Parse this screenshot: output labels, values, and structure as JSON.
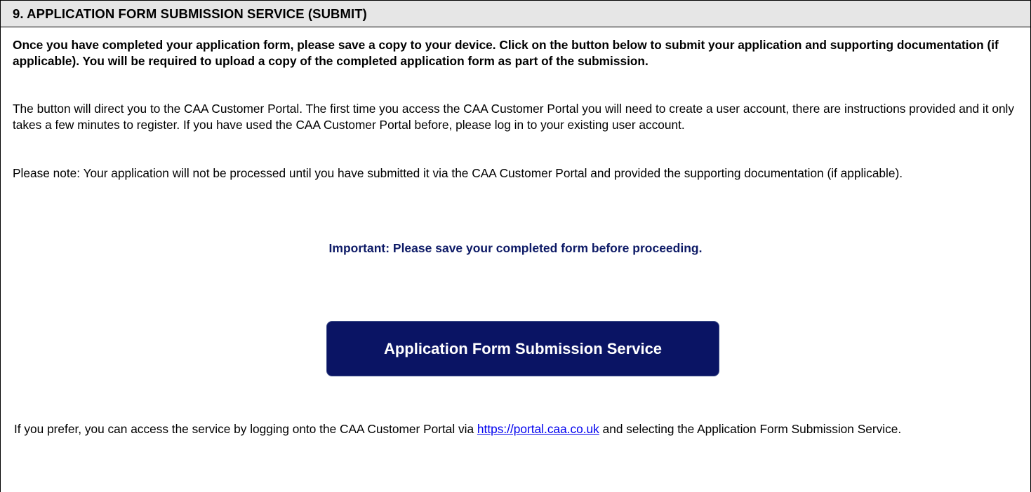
{
  "header": {
    "title": "9. APPLICATION FORM SUBMISSION SERVICE (SUBMIT)"
  },
  "intro": {
    "bold_text": "Once you have completed your application form, please save a copy to your device. Click on the button below to submit your application and supporting documentation (if applicable). You will be required to upload a copy of the completed application form as part of the submission."
  },
  "portal_info": {
    "text": "The button will direct you to the CAA Customer Portal. The first time you access the CAA Customer Portal you will need to create a user account, there are instructions provided and it only takes a few minutes to register.  If you have used the CAA Customer Portal before, please log in to your existing user account."
  },
  "note": {
    "text": "Please note: Your application will not be processed until you have submitted it via the CAA Customer Portal and provided the supporting documentation (if applicable)."
  },
  "important": {
    "text": "Important: Please save your completed form before proceeding."
  },
  "submit_button": {
    "label": "Application Form Submission Service"
  },
  "alternative": {
    "prefix": "If you prefer, you can access the service by logging onto the CAA Customer Portal via ",
    "link_text": "https://portal.caa.co.uk",
    "suffix": " and selecting the Application Form Submission Service."
  },
  "colors": {
    "header_bg": "#e6e6e6",
    "button_bg": "#0a1464",
    "important_text": "#0d1a66",
    "link": "#0000ee"
  }
}
